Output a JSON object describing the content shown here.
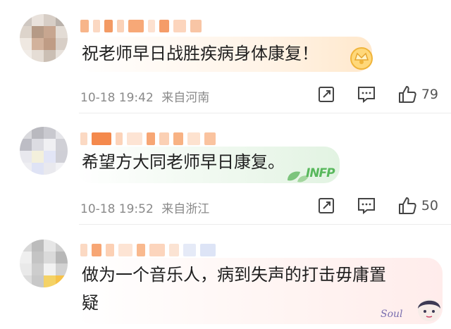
{
  "comments": [
    {
      "text": "祝老师早日战胜疾病身体康复！",
      "time": "10-18 19:42",
      "location": "来自河南",
      "likes": "79"
    },
    {
      "text": "希望方大同老师早日康复。",
      "time": "10-18 19:52",
      "location": "来自浙江",
      "likes": "50",
      "badge": "INFP"
    },
    {
      "text_line1": "做为一个音乐人，病到失声的打击毋庸置",
      "text_line2": "疑",
      "sticker_label": "Soul"
    }
  ],
  "icons": {
    "repost": "share-icon",
    "reply": "comment-icon",
    "like": "thumbs-up-icon"
  },
  "colors": {
    "text": "#1f1f1f",
    "meta": "#8a8a8a",
    "username_blur": "#f6a06a",
    "divider": "#ececec"
  }
}
